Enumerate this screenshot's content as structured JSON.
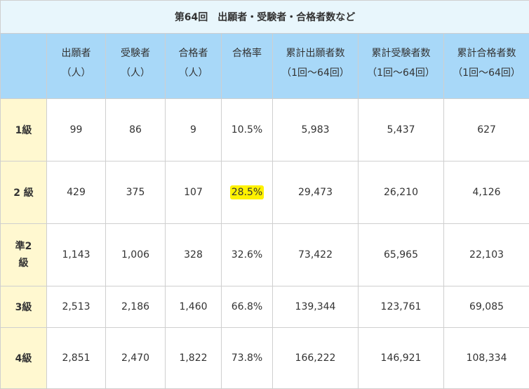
{
  "title": "第64回　出願者・受験者・合格者数など",
  "headers": [
    {
      "l1": "出願者",
      "l2": "（人）"
    },
    {
      "l1": "受験者",
      "l2": "（人）"
    },
    {
      "l1": "合格者",
      "l2": "（人）"
    },
    {
      "l1": "合格率",
      "l2": ""
    },
    {
      "l1": "累計出願者数",
      "l2": "（1回〜64回）"
    },
    {
      "l1": "累計受験者数",
      "l2": "（1回〜64回）"
    },
    {
      "l1": "累計合格者数",
      "l2": "（1回〜64回）"
    }
  ],
  "rows": [
    {
      "grade": "1級",
      "applicants": "99",
      "examinees": "86",
      "passed": "9",
      "rate": "10.5%",
      "cum_applicants": "5,983",
      "cum_examinees": "5,437",
      "cum_passed": "627"
    },
    {
      "grade": "2 級",
      "applicants": "429",
      "examinees": "375",
      "passed": "107",
      "rate": "28.5%",
      "cum_applicants": "29,473",
      "cum_examinees": "26,210",
      "cum_passed": "4,126"
    },
    {
      "grade": "準2",
      "grade_l2": "級",
      "applicants": "1,143",
      "examinees": "1,006",
      "passed": "328",
      "rate": "32.6%",
      "cum_applicants": "73,422",
      "cum_examinees": "65,965",
      "cum_passed": "22,103"
    },
    {
      "grade": "3級",
      "applicants": "2,513",
      "examinees": "2,186",
      "passed": "1,460",
      "rate": "66.8%",
      "cum_applicants": "139,344",
      "cum_examinees": "123,761",
      "cum_passed": "69,085"
    },
    {
      "grade": "4級",
      "applicants": "2,851",
      "examinees": "2,470",
      "passed": "1,822",
      "rate": "73.8%",
      "cum_applicants": "166,222",
      "cum_examinees": "146,921",
      "cum_passed": "108,334"
    }
  ],
  "colors": {
    "title_bg": "#e8f6fc",
    "header_bg": "#a8d8f8",
    "rowhead_bg": "#fff8d0",
    "highlight": "#fff200"
  }
}
